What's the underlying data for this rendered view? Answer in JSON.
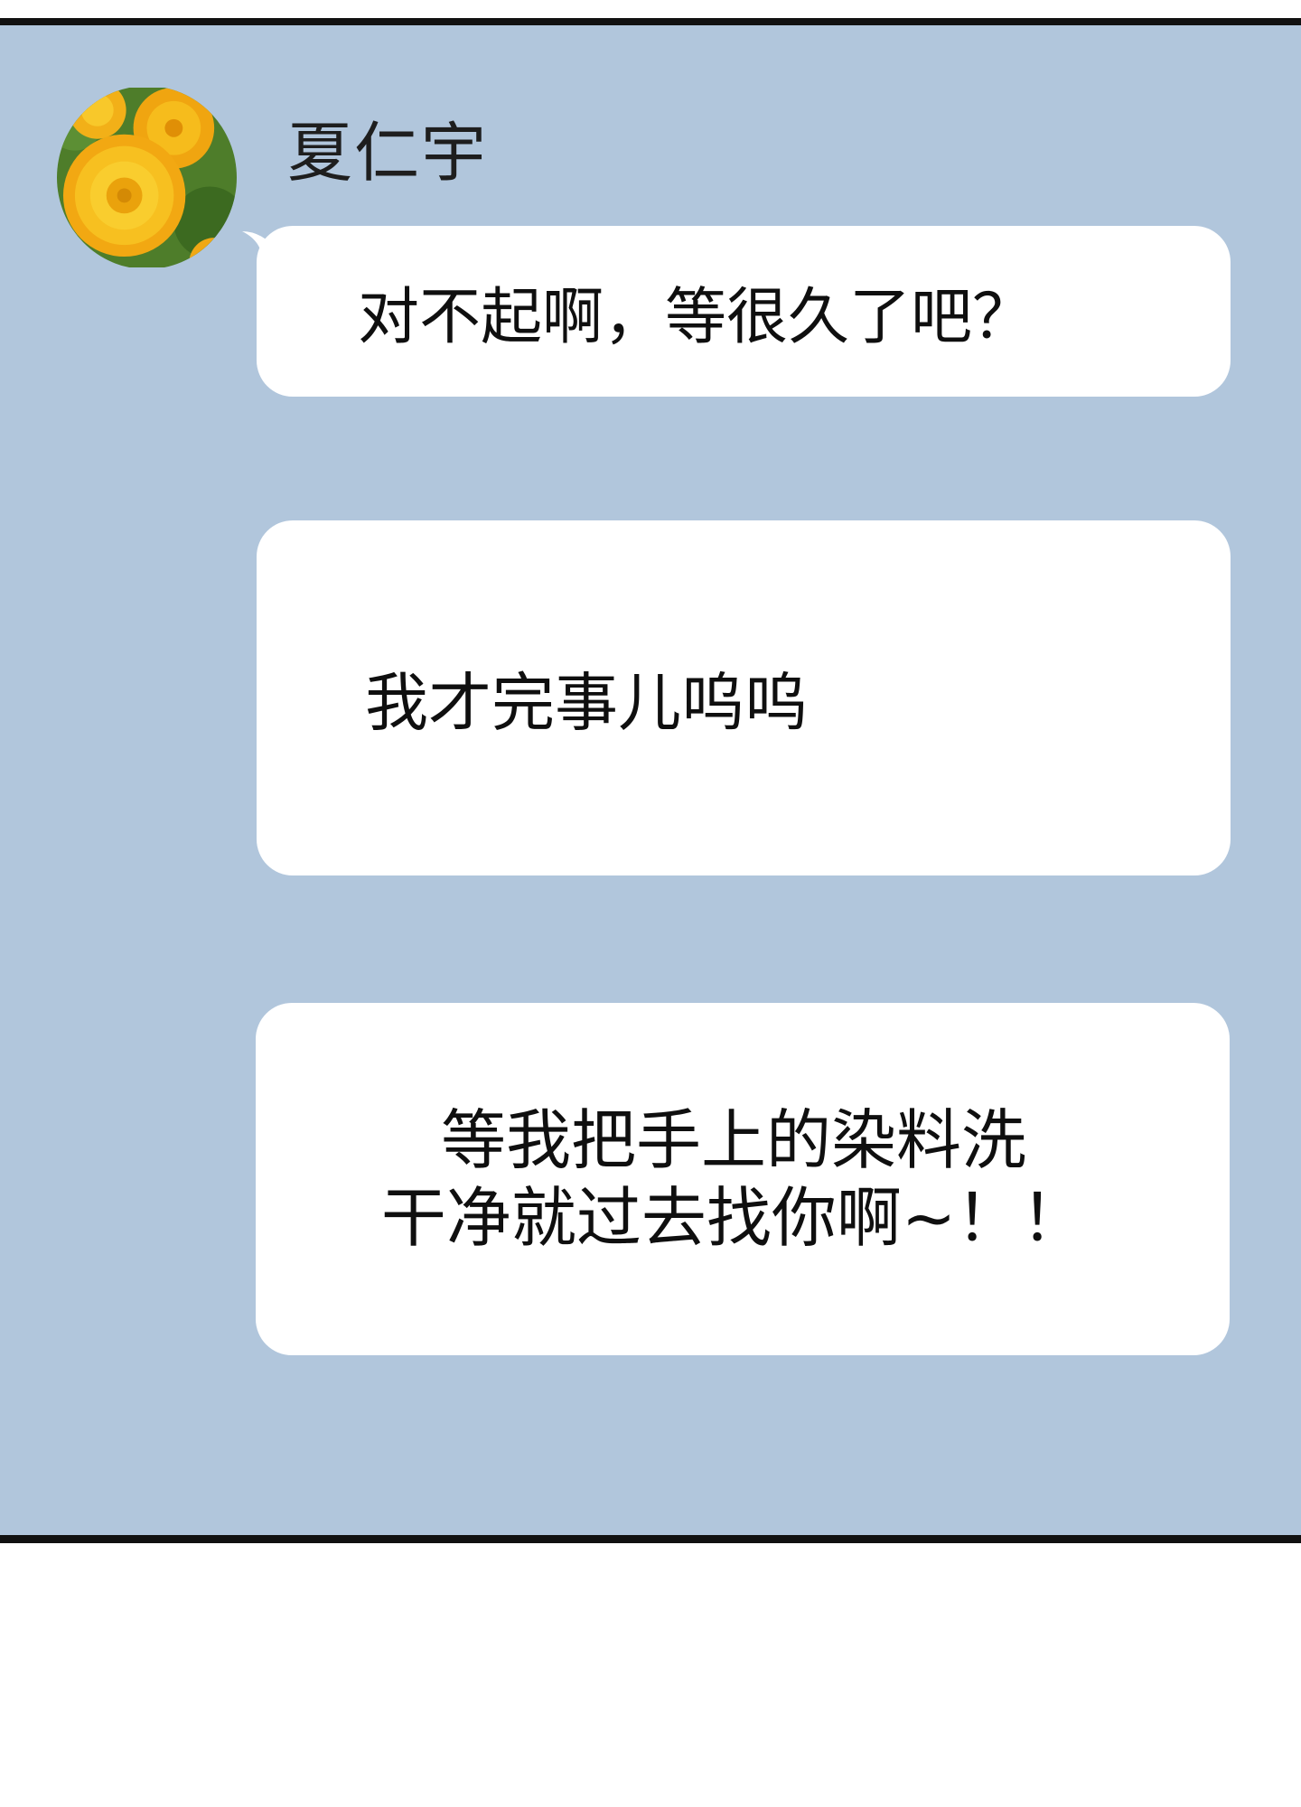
{
  "chat": {
    "contact_name": "夏仁宇",
    "avatar_icon": "dandelion-avatar-icon",
    "messages": [
      {
        "text": "对不起啊，等很久了吧？"
      },
      {
        "text": "我才完事儿呜呜"
      },
      {
        "text": " 等我把手上的染料洗\n干净就过去找你啊~！！"
      }
    ]
  },
  "colors": {
    "background": "#b1c6dc",
    "bubble": "#ffffff",
    "border": "#111111"
  }
}
